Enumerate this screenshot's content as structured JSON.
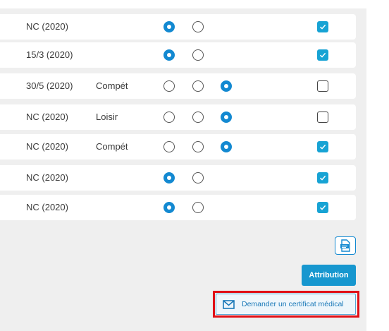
{
  "rows": [
    {
      "date": "NC (2020)",
      "type": "",
      "radios": [
        true,
        false
      ],
      "checked": true
    },
    {
      "date": "15/3 (2020)",
      "type": "",
      "radios": [
        true,
        false
      ],
      "checked": true
    },
    {
      "date": "30/5 (2020)",
      "type": "Compét",
      "radios": [
        false,
        false,
        true
      ],
      "checked": false
    },
    {
      "date": "NC (2020)",
      "type": "Loisir",
      "radios": [
        false,
        false,
        true
      ],
      "checked": false
    },
    {
      "date": "NC (2020)",
      "type": "Compét",
      "radios": [
        false,
        false,
        true
      ],
      "checked": true
    },
    {
      "date": "NC (2020)",
      "type": "",
      "radios": [
        true,
        false
      ],
      "checked": true
    },
    {
      "date": "NC (2020)",
      "type": "",
      "radios": [
        true,
        false
      ],
      "checked": true
    }
  ],
  "actions": {
    "export_icon": "xlsx-export-icon",
    "attribution_label": "Attribution",
    "certificate_label": "Demander un certificat médical",
    "certificate_icon": "envelope-icon"
  },
  "colors": {
    "primary": "#1389d1",
    "checkbox": "#17a3d4",
    "highlight": "#e10f16",
    "panel": "#efefef"
  }
}
